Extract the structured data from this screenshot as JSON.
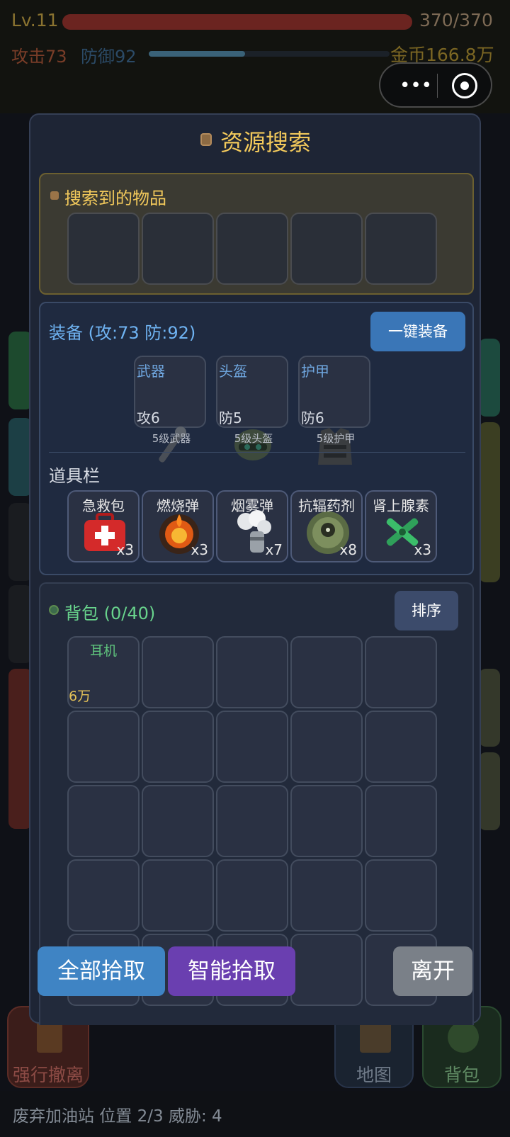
{
  "hud": {
    "level": "Lv.11",
    "hp_text": "370/370",
    "hp_fill": 1.0,
    "attack": "攻击73",
    "defense": "防御92",
    "exp_fill": 0.4,
    "gold": "金币166.8万",
    "menu_glyph": "•••"
  },
  "modal": {
    "title": "资源搜索",
    "found": {
      "title": "搜索到的物品"
    },
    "equipment": {
      "title": "装备 (攻:73 防:92)",
      "equip_all_button": "一键装备",
      "slots": [
        {
          "name": "武器",
          "value": "攻6",
          "level": "5级武器"
        },
        {
          "name": "头盔",
          "value": "防5",
          "level": "5级头盔"
        },
        {
          "name": "护甲",
          "value": "防6",
          "level": "5级护甲"
        }
      ],
      "tools_title": "道具栏",
      "tools": [
        {
          "name": "急救包",
          "count": "x3"
        },
        {
          "name": "燃烧弹",
          "count": "x3"
        },
        {
          "name": "烟雾弹",
          "count": "x7"
        },
        {
          "name": "抗辐药剂",
          "count": "x8"
        },
        {
          "name": "肾上腺素",
          "count": "x3"
        }
      ]
    },
    "backpack": {
      "title": "背包 (0/40)",
      "sort_button": "排序",
      "items": [
        {
          "name": "耳机",
          "value": "6万"
        }
      ]
    },
    "actions": {
      "pick_all": "全部拾取",
      "smart_pick": "智能拾取",
      "leave": "离开"
    }
  },
  "background": {
    "force_evac": "强行撤离",
    "map": "地图",
    "bag": "背包",
    "location": "废弃加油站  位置 2/3  威胁: 4"
  },
  "colors": {
    "gold_accent": "#f2c95b",
    "blue_accent": "#6fb3f2",
    "green_accent": "#68d38c",
    "pick_all_btn": "#3f84c4",
    "smart_pick_btn": "#6a3fb0",
    "leave_btn": "#7a8088"
  }
}
